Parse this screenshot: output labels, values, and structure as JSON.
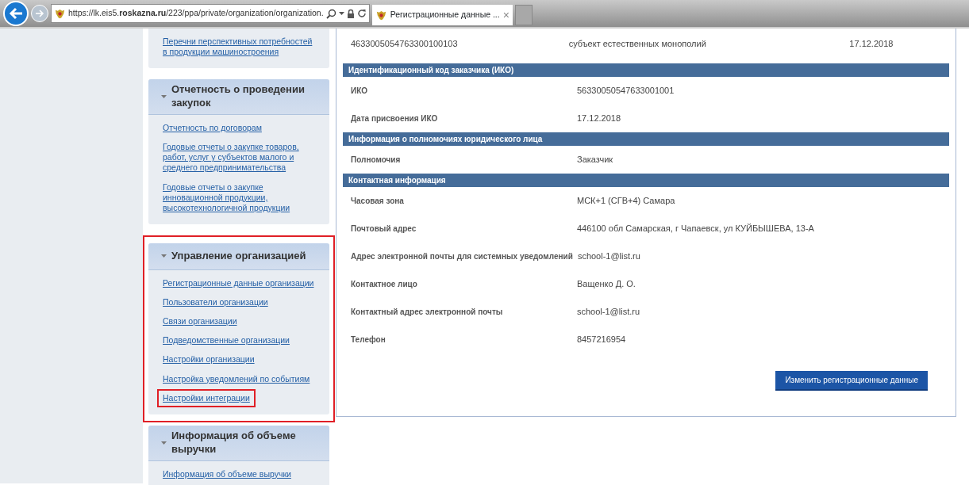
{
  "browser": {
    "url": "https://lk.eis5.**roskazna.ru**/223/ppa/private/organization/organization.",
    "tab": {
      "title": "Регистрационные данные ...",
      "close": "×",
      "selected": true
    }
  },
  "sidebar": {
    "sections": [
      {
        "links": [
          {
            "label": "Перечни перспективных потребностей в продукции машиностроения",
            "highlighted": false
          }
        ]
      },
      {
        "title": "Отчетность о проведении закупок",
        "expanded": true,
        "highlighted": false,
        "links": [
          {
            "label": "Отчетность по договорам",
            "highlighted": false
          },
          {
            "label": "Годовые отчеты о закупке товаров, работ, услуг у субъектов малого и среднего предпринимательства",
            "highlighted": false
          },
          {
            "label": "Годовые отчеты о закупке инновационной продукции, высокотехнологичной продукции",
            "highlighted": false
          }
        ]
      },
      {
        "title": "Управление организацией",
        "expanded": true,
        "highlighted": true,
        "links": [
          {
            "label": "Регистрационные данные организации",
            "highlighted": false
          },
          {
            "label": "Пользователи организации",
            "highlighted": false
          },
          {
            "label": "Связи организации",
            "highlighted": false
          },
          {
            "label": "Подведомственные организации",
            "highlighted": false
          },
          {
            "label": "Настройки организации",
            "highlighted": false
          },
          {
            "label": "Настройка уведомлений по событиям",
            "highlighted": false
          },
          {
            "label": "Настройки интеграции",
            "highlighted": true
          }
        ]
      },
      {
        "title": "Информация об объеме выручки",
        "expanded": true,
        "highlighted": false,
        "links": [
          {
            "label": "Информация об объеме выручки",
            "highlighted": false
          }
        ]
      }
    ]
  },
  "main": {
    "top_row": {
      "column_1": "4633005054763300100103",
      "column_2": "субъект естественных монополий",
      "column_3": "17.12.2018"
    },
    "sections": [
      {
        "title": "Идентификационный код заказчика (ИКО)",
        "rows": [
          {
            "label": "ИКО",
            "value": "56330050547633001001"
          },
          {
            "label": "Дата присвоения ИКО",
            "value": "17.12.2018"
          }
        ]
      },
      {
        "title": "Информация о полномочиях юридического лица",
        "rows": [
          {
            "label": "Полномочия",
            "value": "Заказчик"
          }
        ]
      },
      {
        "title": "Контактная информация",
        "rows": [
          {
            "label": "Часовая зона",
            "value": "МСК+1 (СГВ+4) Самара"
          },
          {
            "label": "Почтовый адрес",
            "value": "446100 обл Самарская, г Чапаевск, ул КУЙБЫШЕВА, 13-А"
          },
          {
            "label": "Адрес электронной почты для системных уведомлений",
            "value": "school-1@list.ru"
          },
          {
            "label": "Контактное лицо",
            "value": "Ващенко Д. О."
          },
          {
            "label": "Контактный адрес электронной почты",
            "value": "school-1@list.ru"
          },
          {
            "label": "Телефон",
            "value": "8457216954"
          }
        ]
      }
    ],
    "button": "Изменить регистрационные данные"
  }
}
